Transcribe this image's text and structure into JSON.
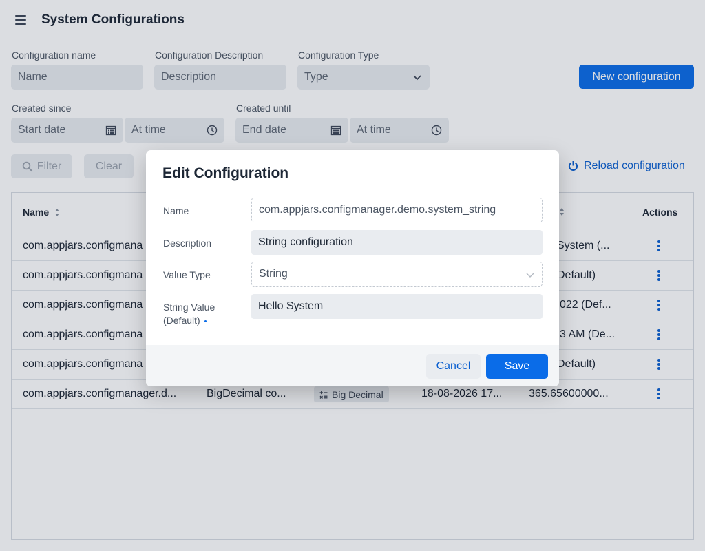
{
  "header": {
    "title": "System Configurations",
    "menu_icon": "hamburger-menu-icon"
  },
  "filters": {
    "name_label": "Configuration name",
    "name_placeholder": "Name",
    "desc_label": "Configuration Description",
    "desc_placeholder": "Description",
    "type_label": "Configuration Type",
    "type_placeholder": "Type",
    "created_since_label": "Created since",
    "start_date_placeholder": "Start date",
    "at_time_placeholder": "At time",
    "created_until_label": "Created until",
    "end_date_placeholder": "End date",
    "filter_button": "Filter",
    "clear_button": "Clear"
  },
  "actions": {
    "new_configuration": "New configuration",
    "reload_configuration": "Reload configuration"
  },
  "grid": {
    "columns": {
      "name": "Name",
      "actions": "Actions"
    },
    "rows": [
      {
        "name": "com.appjars.configmana",
        "value_tail": "System (..."
      },
      {
        "name": "com.appjars.configmana",
        "value_tail": "Default)"
      },
      {
        "name": "com.appjars.configmana",
        "value_tail": "022 (Def..."
      },
      {
        "name": "com.appjars.configmana",
        "value_tail": "3 AM (De..."
      },
      {
        "name": "com.appjars.configmana",
        "value_tail": "Default)"
      },
      {
        "name": "com.appjars.configmanager.d...",
        "description": "BigDecimal co...",
        "type": "Big Decimal",
        "created": "18-08-2026 17...",
        "value": "365.65600000..."
      }
    ]
  },
  "dialog": {
    "title": "Edit Configuration",
    "name_label": "Name",
    "name_value": "com.appjars.configmanager.demo.system_string",
    "description_label": "Description",
    "description_value": "String configuration",
    "value_type_label": "Value Type",
    "value_type_value": "String",
    "string_value_label_1": "String Value",
    "string_value_label_2": "(Default)",
    "string_value_value": "Hello System",
    "cancel": "Cancel",
    "save": "Save"
  },
  "colors": {
    "primary": "#0a6ce8",
    "link": "#0a5fd0",
    "field_bg": "#e9ecf0",
    "text": "#1d2735"
  }
}
